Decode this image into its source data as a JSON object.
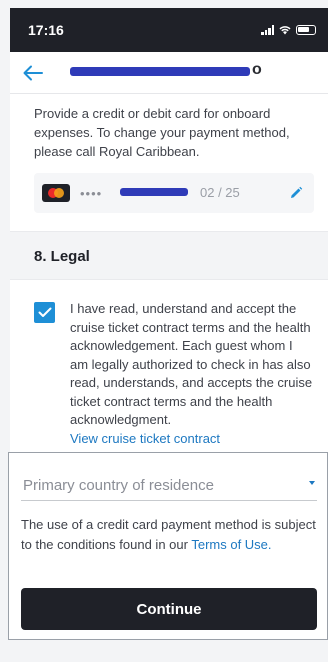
{
  "status_bar": {
    "time": "17:16"
  },
  "header": {
    "title_visible_fragment": "o"
  },
  "payment": {
    "intro": "Provide a credit or debit card for onboard expenses. To change your payment method, please call Royal Caribbean.",
    "card_mask": "••••",
    "card_expiry": "02 / 25"
  },
  "legal": {
    "section_title": "8. Legal",
    "consent_checked": true,
    "consent_text": "I have read, understand and accept the cruise ticket contract terms and the health acknowledgement. Each guest whom I am legally authorized to check in has also read, understands, and accepts the cruise ticket contract terms and the health acknowledgment.",
    "contract_link": "View cruise ticket contract"
  },
  "residence": {
    "placeholder": "Primary country of residence"
  },
  "terms": {
    "text": "The use of a credit card payment method is subject to the conditions found in our",
    "link": "Terms of Use."
  },
  "actions": {
    "continue_label": "Continue"
  },
  "colors": {
    "dark": "#1f2128",
    "accent_blue": "#1e8fd6",
    "link_blue": "#1d78c1",
    "redaction": "#2f3bb8"
  }
}
